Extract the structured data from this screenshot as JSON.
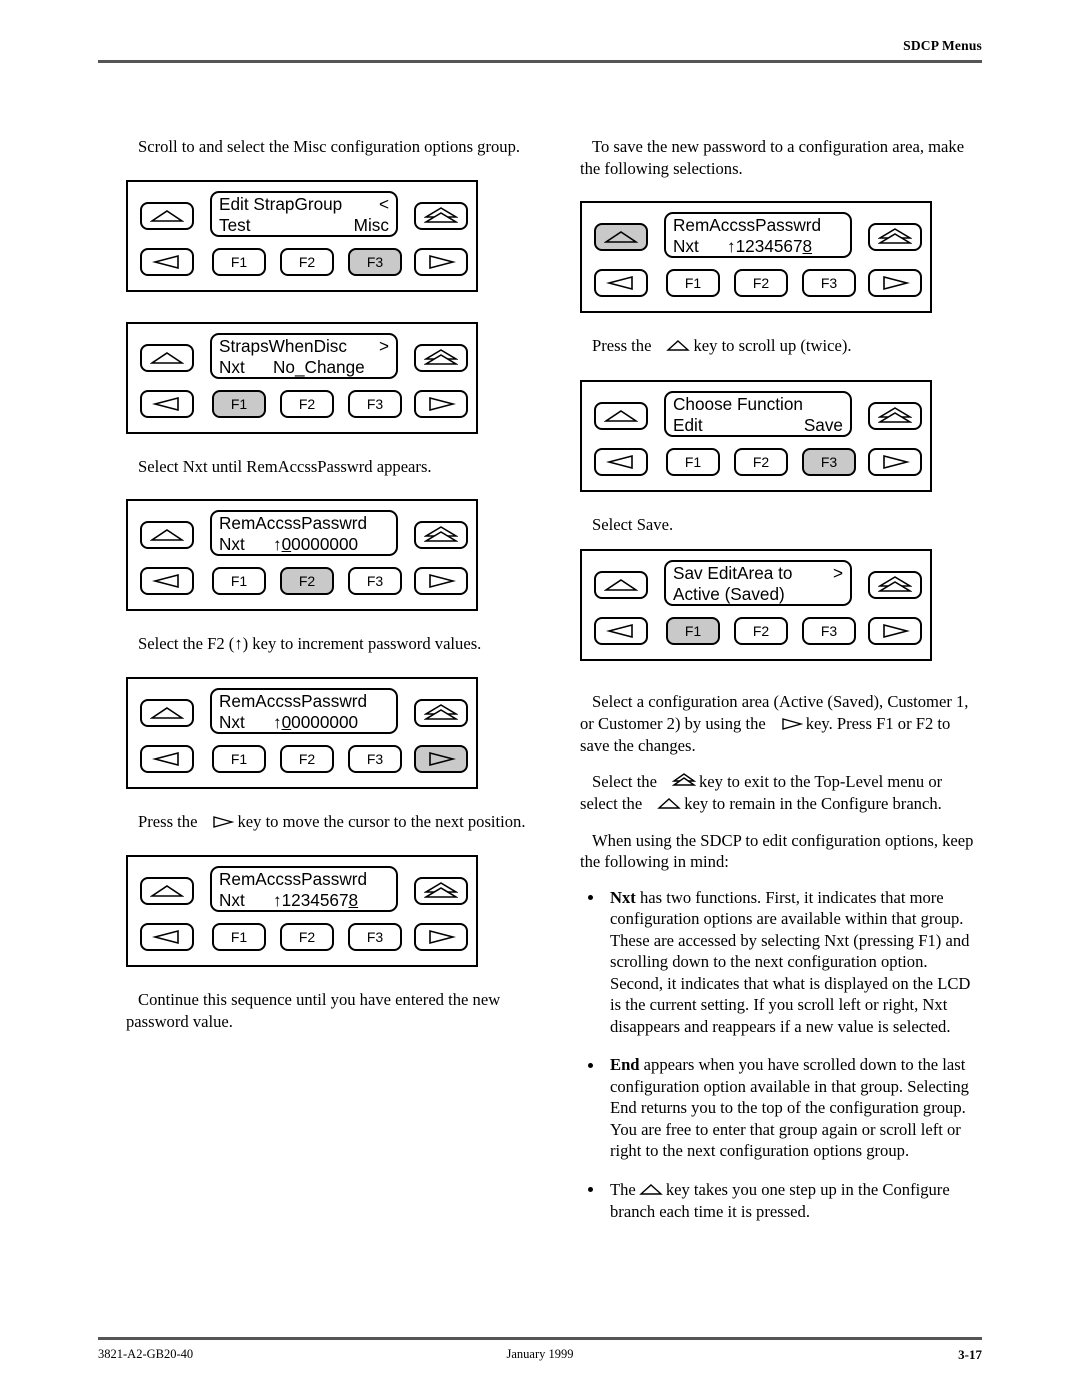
{
  "header": {
    "title": "SDCP Menus"
  },
  "footer": {
    "doc_number": "3821-A2-GB20-40",
    "date": "January 1999",
    "page_number": "3-17"
  },
  "left_column": {
    "para_1": "Scroll to and select the Misc configuration options group.",
    "panel_1": {
      "lcd": {
        "line1_left": "Edit StrapGroup",
        "line1_right": "<",
        "line2_left": "Test",
        "line2_right": "Misc"
      },
      "keys": {
        "up": "up-arrow",
        "top_level": "double-up-arrow",
        "left": "left-arrow",
        "right": "right-arrow",
        "f1": "F1",
        "f2": "F2",
        "f3": "F3"
      },
      "highlighted_key": "F3"
    },
    "panel_2": {
      "lcd": {
        "line1_left": "StrapsWhenDisc",
        "line1_right": ">",
        "line2_left": "Nxt",
        "line2_mid": "No_Change"
      },
      "keys": {
        "f1": "F1",
        "f2": "F2",
        "f3": "F3"
      },
      "highlighted_key": "F1"
    },
    "para_2": "Select Nxt until RemAccssPasswrd appears.",
    "panel_3": {
      "lcd": {
        "line1_left": "RemAccssPasswrd",
        "line2_left": "Nxt",
        "line2_arrow": "↑",
        "line2_cursor_char": "0",
        "line2_rest": "0000000"
      },
      "keys": {
        "f1": "F1",
        "f2": "F2",
        "f3": "F3"
      },
      "highlighted_key": "F2"
    },
    "para_3": "Select the F2 (↑) key to increment password values.",
    "panel_4": {
      "lcd": {
        "line1_left": "RemAccssPasswrd",
        "line2_left": "Nxt",
        "line2_arrow": "↑",
        "line2_cursor_char": "0",
        "line2_rest": "0000000"
      },
      "keys": {
        "f1": "F1",
        "f2": "F2",
        "f3": "F3"
      },
      "highlighted_key": "right-arrow"
    },
    "para_4_before": "Press the",
    "para_4_after": "key to move the cursor to the next position.",
    "panel_5": {
      "lcd": {
        "line1_left": "RemAccssPasswrd",
        "line2_left": "Nxt",
        "line2_arrow": "↑",
        "line2_pre": "1234567",
        "line2_cursor_char": "8"
      },
      "keys": {
        "f1": "F1",
        "f2": "F2",
        "f3": "F3"
      },
      "highlighted_key": "none"
    },
    "para_5": "Continue this sequence until you have entered the new password value."
  },
  "right_column": {
    "para_1": "To save the new password to a configuration area, make the following selections.",
    "panel_1": {
      "lcd": {
        "line1_left": "RemAccssPasswrd",
        "line2_left": "Nxt",
        "line2_arrow": "↑",
        "line2_pre": "1234567",
        "line2_cursor_char": "8"
      },
      "keys": {
        "f1": "F1",
        "f2": "F2",
        "f3": "F3"
      },
      "highlighted_key": "up-arrow"
    },
    "para_2_before": "Press the",
    "para_2_after": "key to scroll up (twice).",
    "panel_2": {
      "lcd": {
        "line1_left": "Choose Function",
        "line2_left": "Edit",
        "line2_right": "Save"
      },
      "keys": {
        "f1": "F1",
        "f2": "F2",
        "f3": "F3"
      },
      "highlighted_key": "F3"
    },
    "para_3": "Select Save.",
    "panel_3": {
      "lcd": {
        "line1_left": "Sav EditArea to",
        "line1_right": ">",
        "line2_left": "Active (Saved)"
      },
      "keys": {
        "f1": "F1",
        "f2": "F2",
        "f3": "F3"
      },
      "highlighted_key": "F1"
    },
    "para_4_a": "Select a configuration area (Active (Saved), Customer 1, or Customer 2) by using the",
    "para_4_b": "key. Press F1 or F2 to save the changes.",
    "para_5_a": "Select the",
    "para_5_b": "key to exit to the Top-Level menu or select the",
    "para_5_c": "key to remain in the Configure branch.",
    "para_6": "When using the SDCP to edit configuration options, keep the following in mind:",
    "bullets": [
      {
        "lead": "Nxt",
        "text": " has two functions. First, it indicates that more configuration options are available within that group. These are accessed by selecting Nxt (pressing F1) and scrolling down to the next configuration option. Second, it indicates that what is displayed on the LCD is the current setting. If you scroll left or right, Nxt disappears and reappears if a new value is selected."
      },
      {
        "lead": "End",
        "text": " appears when you have scrolled down to the last configuration option available in that group. Selecting End returns you to the top of the configuration group. You are free to enter that group again or scroll left or right to the next configuration options group."
      }
    ],
    "bullet_3_before": "The",
    "bullet_3_after": "key takes you one step up in the Configure branch each time it is pressed."
  },
  "colors": {
    "highlight": "#c9c9c9",
    "rule": "#555555",
    "ink": "#000000"
  }
}
